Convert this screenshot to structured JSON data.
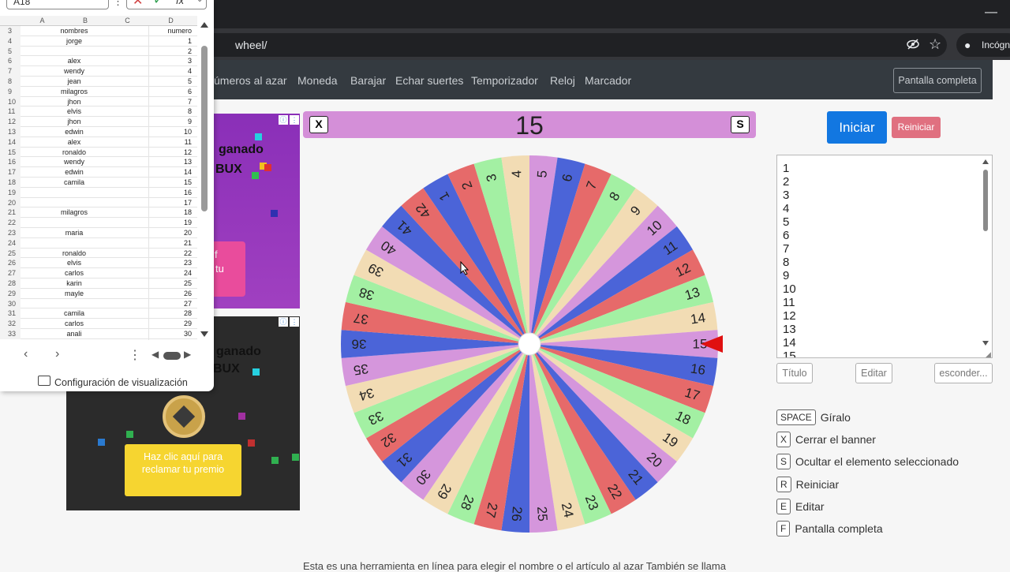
{
  "browser": {
    "url": "wheel/",
    "incognito_label": "Incógni"
  },
  "nav": {
    "links": [
      "úmeros al azar",
      "Moneda",
      "Barajar",
      "Echar suertes",
      "Temporizador",
      "Reloj",
      "Marcador"
    ],
    "fullscreen_label": "Pantalla completa"
  },
  "ads": {
    "ad1_line1": "ganado",
    "ad1_line2": "BUX",
    "ad1_btn_line1": "f",
    "ad1_btn_line2": "tu",
    "ad2_line1": "ganado",
    "ad2_line2": "BUX",
    "ad2_btn": "Haz clic aquí para reclamar tu premio",
    "ad1_bg": "#7b2ea8",
    "ad2_bg": "#2b2b2b"
  },
  "banner": {
    "close_key": "X",
    "hide_key": "S",
    "selected": "15",
    "bg_color": "#d48fd8"
  },
  "controls": {
    "start_label": "Iniciar",
    "reset_label": "Reiniciar",
    "title_label": "Título",
    "edit_label": "Editar",
    "hide_label": "esconder..."
  },
  "entries": [
    "1",
    "2",
    "3",
    "4",
    "5",
    "6",
    "7",
    "8",
    "9",
    "10",
    "11",
    "12",
    "13",
    "14",
    "15"
  ],
  "wheel": {
    "segments": 42,
    "pointer_color": "#e01010",
    "palette": [
      "#4b64d8",
      "#e66a6a",
      "#a3f0a3",
      "#f2dcb4",
      "#d596dc"
    ]
  },
  "shortcuts": [
    {
      "key": "SPACE",
      "label": "Gíralo"
    },
    {
      "key": "X",
      "label": "Cerrar el banner"
    },
    {
      "key": "S",
      "label": "Ocultar el elemento seleccionado"
    },
    {
      "key": "R",
      "label": "Reiniciar"
    },
    {
      "key": "E",
      "label": "Editar"
    },
    {
      "key": "F",
      "label": "Pantalla completa"
    }
  ],
  "footer_text": "Esta es una herramienta en línea para elegir el nombre o el artículo al azar También se llama",
  "sheet": {
    "name_box": "A18",
    "formula_icon": "fx",
    "columns": [
      "A",
      "B",
      "C",
      "D"
    ],
    "rows": [
      {
        "n": "3",
        "b": "nombres",
        "d": "numero"
      },
      {
        "n": "4",
        "b": "jorge",
        "d": "1"
      },
      {
        "n": "5",
        "b": "",
        "d": "2"
      },
      {
        "n": "6",
        "b": "alex",
        "d": "3"
      },
      {
        "n": "7",
        "b": "wendy",
        "d": "4"
      },
      {
        "n": "8",
        "b": "jean",
        "d": "5"
      },
      {
        "n": "9",
        "b": "milagros",
        "d": "6"
      },
      {
        "n": "10",
        "b": "jhon",
        "d": "7"
      },
      {
        "n": "11",
        "b": "elvis",
        "d": "8"
      },
      {
        "n": "12",
        "b": "jhon",
        "d": "9"
      },
      {
        "n": "13",
        "b": "edwin",
        "d": "10"
      },
      {
        "n": "14",
        "b": "alex",
        "d": "11"
      },
      {
        "n": "15",
        "b": "ronaldo",
        "d": "12"
      },
      {
        "n": "16",
        "b": "wendy",
        "d": "13"
      },
      {
        "n": "17",
        "b": "edwin",
        "d": "14"
      },
      {
        "n": "18",
        "b": "camila",
        "d": "15"
      },
      {
        "n": "19",
        "b": "",
        "d": "16"
      },
      {
        "n": "20",
        "b": "",
        "d": "17"
      },
      {
        "n": "21",
        "b": "milagros",
        "d": "18"
      },
      {
        "n": "22",
        "b": "",
        "d": "19"
      },
      {
        "n": "23",
        "b": "maria",
        "d": "20"
      },
      {
        "n": "24",
        "b": "",
        "d": "21"
      },
      {
        "n": "25",
        "b": "ronaldo",
        "d": "22"
      },
      {
        "n": "26",
        "b": "elvis",
        "d": "23"
      },
      {
        "n": "27",
        "b": "carlos",
        "d": "24"
      },
      {
        "n": "28",
        "b": "karin",
        "d": "25"
      },
      {
        "n": "29",
        "b": "mayle",
        "d": "26"
      },
      {
        "n": "30",
        "b": "",
        "d": "27"
      },
      {
        "n": "31",
        "b": "camila",
        "d": "28"
      },
      {
        "n": "32",
        "b": "carlos",
        "d": "29"
      },
      {
        "n": "33",
        "b": "anali",
        "d": "30"
      }
    ],
    "footer_label": "Configuración de visualización"
  }
}
